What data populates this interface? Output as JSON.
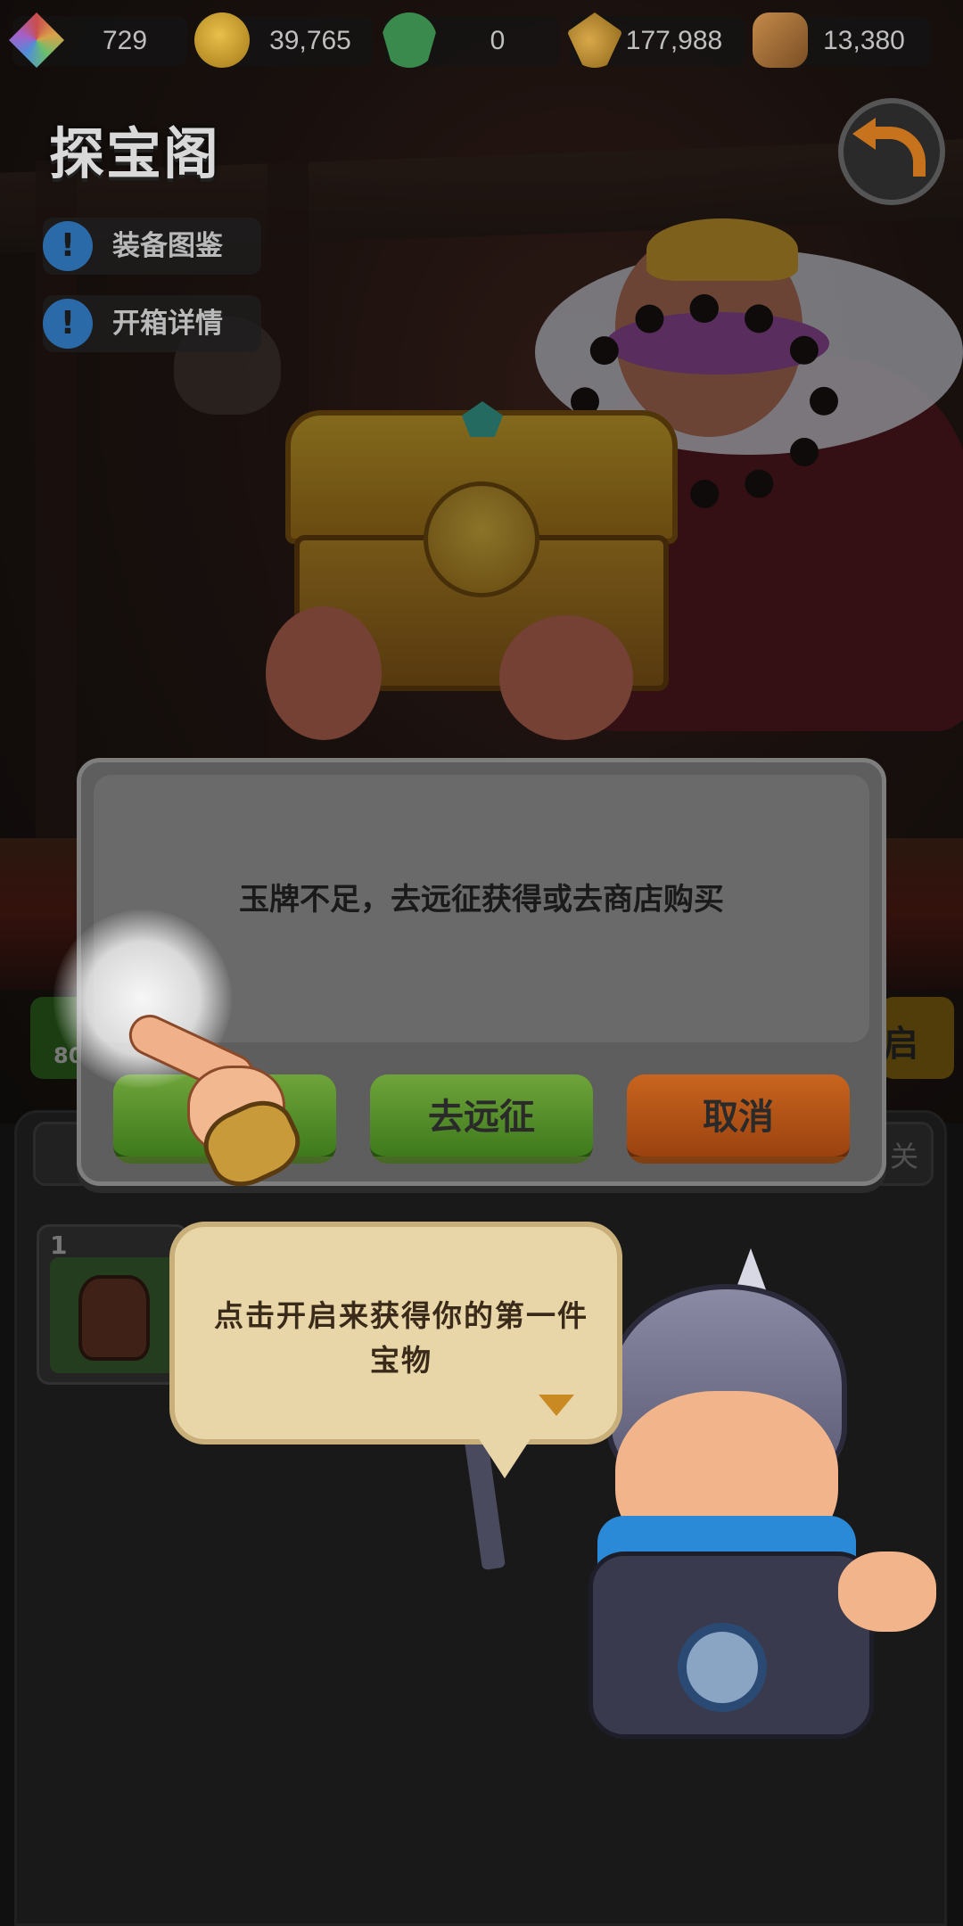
{
  "resources": [
    {
      "icon": "gem-icon",
      "value": "729"
    },
    {
      "icon": "gold-coin-icon",
      "value": "39,765"
    },
    {
      "icon": "jade-token-icon",
      "value": "0"
    },
    {
      "icon": "wheat-icon",
      "value": "177,988"
    },
    {
      "icon": "wood-log-icon",
      "value": "13,380"
    }
  ],
  "header": {
    "title": "探宝阁",
    "back_icon": "back-arrow-icon"
  },
  "side_buttons": [
    {
      "label": "装备图鉴",
      "icon": "exclamation-icon"
    },
    {
      "label": "开箱详情",
      "icon": "exclamation-icon"
    }
  ],
  "background_buttons": {
    "green_partial": "80",
    "yellow_partial": "启"
  },
  "panel": {
    "tab_close_glyph": "关",
    "item_card_number": "1"
  },
  "dialog": {
    "message": "玉牌不足，去远征获得或去商店购买",
    "buttons": [
      "",
      "去远征",
      "取消"
    ]
  },
  "tutorial": {
    "bubble_text": "点击开启来获得你的第一件宝物"
  },
  "colors": {
    "dialog_bg": "#5e5e5e",
    "green_button": "#4e8a24",
    "orange_button": "#b5541a",
    "bubble_bg": "#e9d6a8",
    "accent_blue": "#2b8ad8"
  }
}
